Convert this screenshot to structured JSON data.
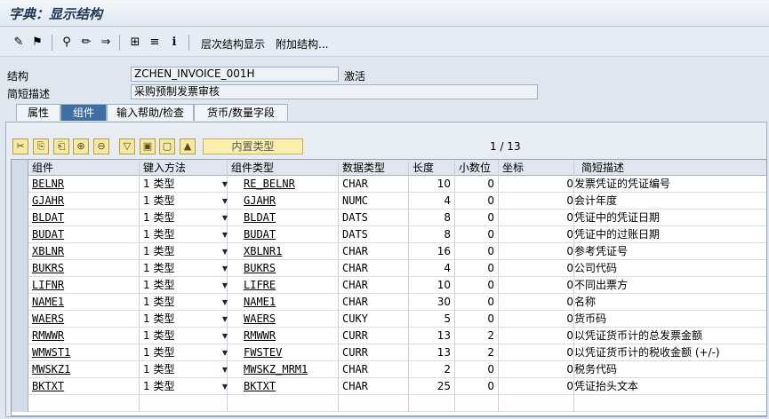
{
  "title": "字典：显示结构",
  "toolbar": {
    "items": [
      "hier-display-icon",
      "activate-icon",
      "where-used-icon",
      "edit-icon",
      "object-list-icon",
      "tree-icon",
      "display-list-icon",
      "info-icon"
    ],
    "hier_label": "层次结构显示",
    "append_label": "附加结构..."
  },
  "header": {
    "struct_label": "结构",
    "struct_value": "ZCHEN_INVOICE_001H",
    "status": "激活",
    "desc_label": "简短描述",
    "desc_value": "采购预制发票审核"
  },
  "tabs": [
    {
      "label": "属性"
    },
    {
      "label": "组件"
    },
    {
      "label": "输入帮助/检查"
    },
    {
      "label": "货币/数量字段"
    }
  ],
  "table": {
    "builtin_label": "内置类型",
    "page_info": "1  /  13",
    "columns": [
      "组件",
      "键入方法",
      "组件类型",
      "数据类型",
      "长度",
      "小数位",
      "坐标",
      "简短描述"
    ],
    "rows": [
      {
        "comp": "BELNR",
        "method": "1 类型",
        "type": "RE_BELNR",
        "dtype": "CHAR",
        "len": "10",
        "dec": "0",
        "coord": "0",
        "desc": "发票凭证的凭证编号"
      },
      {
        "comp": "GJAHR",
        "method": "1 类型",
        "type": "GJAHR",
        "dtype": "NUMC",
        "len": "4",
        "dec": "0",
        "coord": "0",
        "desc": "会计年度"
      },
      {
        "comp": "BLDAT",
        "method": "1 类型",
        "type": "BLDAT",
        "dtype": "DATS",
        "len": "8",
        "dec": "0",
        "coord": "0",
        "desc": "凭证中的凭证日期"
      },
      {
        "comp": "BUDAT",
        "method": "1 类型",
        "type": "BUDAT",
        "dtype": "DATS",
        "len": "8",
        "dec": "0",
        "coord": "0",
        "desc": "凭证中的过账日期"
      },
      {
        "comp": "XBLNR",
        "method": "1 类型",
        "type": "XBLNR1",
        "dtype": "CHAR",
        "len": "16",
        "dec": "0",
        "coord": "0",
        "desc": "参考凭证号"
      },
      {
        "comp": "BUKRS",
        "method": "1 类型",
        "type": "BUKRS",
        "dtype": "CHAR",
        "len": "4",
        "dec": "0",
        "coord": "0",
        "desc": "公司代码"
      },
      {
        "comp": "LIFNR",
        "method": "1 类型",
        "type": "LIFRE",
        "dtype": "CHAR",
        "len": "10",
        "dec": "0",
        "coord": "0",
        "desc": "不同出票方"
      },
      {
        "comp": "NAME1",
        "method": "1 类型",
        "type": "NAME1",
        "dtype": "CHAR",
        "len": "30",
        "dec": "0",
        "coord": "0",
        "desc": "名称"
      },
      {
        "comp": "WAERS",
        "method": "1 类型",
        "type": "WAERS",
        "dtype": "CUKY",
        "len": "5",
        "dec": "0",
        "coord": "0",
        "desc": "货币码"
      },
      {
        "comp": "RMWWR",
        "method": "1 类型",
        "type": "RMWWR",
        "dtype": "CURR",
        "len": "13",
        "dec": "2",
        "coord": "0",
        "desc": "以凭证货币计的总发票金额"
      },
      {
        "comp": "WMWST1",
        "method": "1 类型",
        "type": "FWSTEV",
        "dtype": "CURR",
        "len": "13",
        "dec": "2",
        "coord": "0",
        "desc": "以凭证货币计的税收金额 (+/-)"
      },
      {
        "comp": "MWSKZ1",
        "method": "1 类型",
        "type": "MWSKZ_MRM1",
        "dtype": "CHAR",
        "len": "2",
        "dec": "0",
        "coord": "0",
        "desc": "税务代码"
      },
      {
        "comp": "BKTXT",
        "method": "1 类型",
        "type": "BKTXT",
        "dtype": "CHAR",
        "len": "25",
        "dec": "0",
        "coord": "0",
        "desc": "凭证抬头文本"
      }
    ]
  },
  "colors": {
    "accent": "#3f6ea3",
    "background": "#dfe6ee"
  }
}
